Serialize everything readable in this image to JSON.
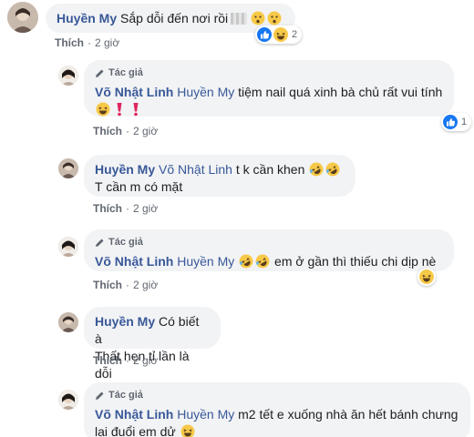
{
  "colors": {
    "name": "#385898",
    "bubble": "#f2f3f5",
    "meta": "#606770",
    "like_blue": "#1877f2"
  },
  "author_badge": "Tác giả",
  "comments": [
    {
      "name": "Huyền My",
      "text": "Sắp dỗi đến nơi rồi",
      "like": "Thích",
      "time": "2 giờ",
      "reaction_count": "2",
      "reactions": [
        "like-icon",
        "haha-icon"
      ]
    },
    {
      "name": "Võ Nhật Linh",
      "tag": "Huyền My",
      "text": "tiệm nail quá xinh bà chủ rất vui tính",
      "like": "Thích",
      "time": "2 giờ",
      "reaction_count": "1",
      "reactions": [
        "like-icon"
      ]
    },
    {
      "name": "Huyền My",
      "tag": "Võ Nhật Linh",
      "text": "t k cần khen",
      "text2": "T cần m có mặt",
      "like": "Thích",
      "time": "2 giờ"
    },
    {
      "name": "Võ Nhật Linh",
      "tag": "Huyền My",
      "text": "em ở gần thì thiếu chi dịp nè",
      "like": "Thích",
      "time": "2 giờ",
      "reactions": [
        "haha-icon"
      ]
    },
    {
      "name": "Huyền My",
      "text": "Có biết à",
      "text2": "Thất hẹn tỉ lần là dỗi",
      "like": "Thích",
      "time": "2 giờ"
    },
    {
      "name": "Võ Nhật Linh",
      "tag": "Huyền My",
      "text": "m2 tết e xuống nhà ăn hết bánh chưng",
      "text2": "lại đuổi em dử"
    }
  ]
}
